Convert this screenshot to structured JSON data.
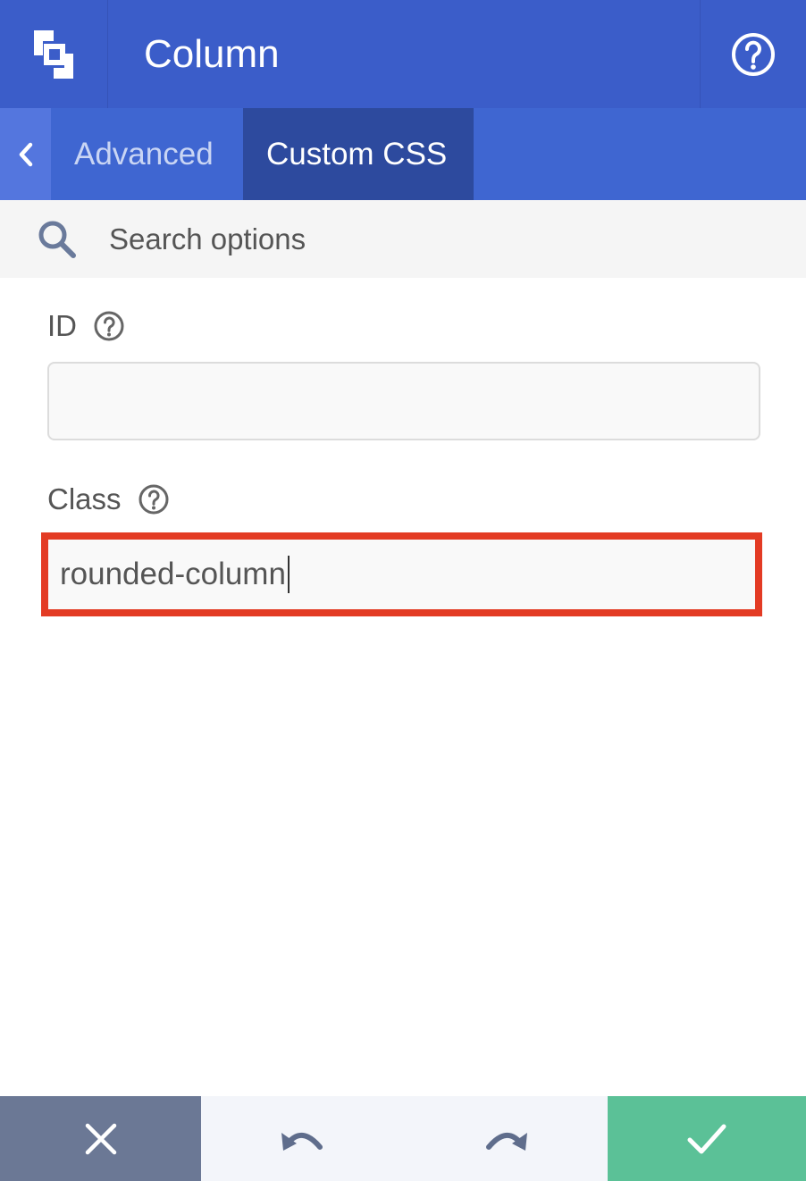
{
  "header": {
    "title": "Column",
    "logo_icon": "builder-logo-icon",
    "help_icon": "help-circle-icon"
  },
  "tabs": {
    "back_icon": "chevron-left-icon",
    "items": [
      {
        "label": "Advanced"
      },
      {
        "label": "Custom CSS"
      }
    ],
    "active": "Custom CSS"
  },
  "search": {
    "placeholder": "Search options",
    "icon": "search-icon"
  },
  "form": {
    "id_field": {
      "label": "ID",
      "value": ""
    },
    "class_field": {
      "label": "Class",
      "value": "rounded-column"
    }
  },
  "footer": {
    "cancel_icon": "close-icon",
    "undo_icon": "undo-icon",
    "redo_icon": "redo-icon",
    "save_icon": "check-icon"
  },
  "colors": {
    "header": "#3b5dc9",
    "tabs": "#3f66d1",
    "active_tab": "#2d4a9e",
    "highlight": "#e33b24",
    "save": "#5bc197",
    "cancel": "#6b7895"
  }
}
